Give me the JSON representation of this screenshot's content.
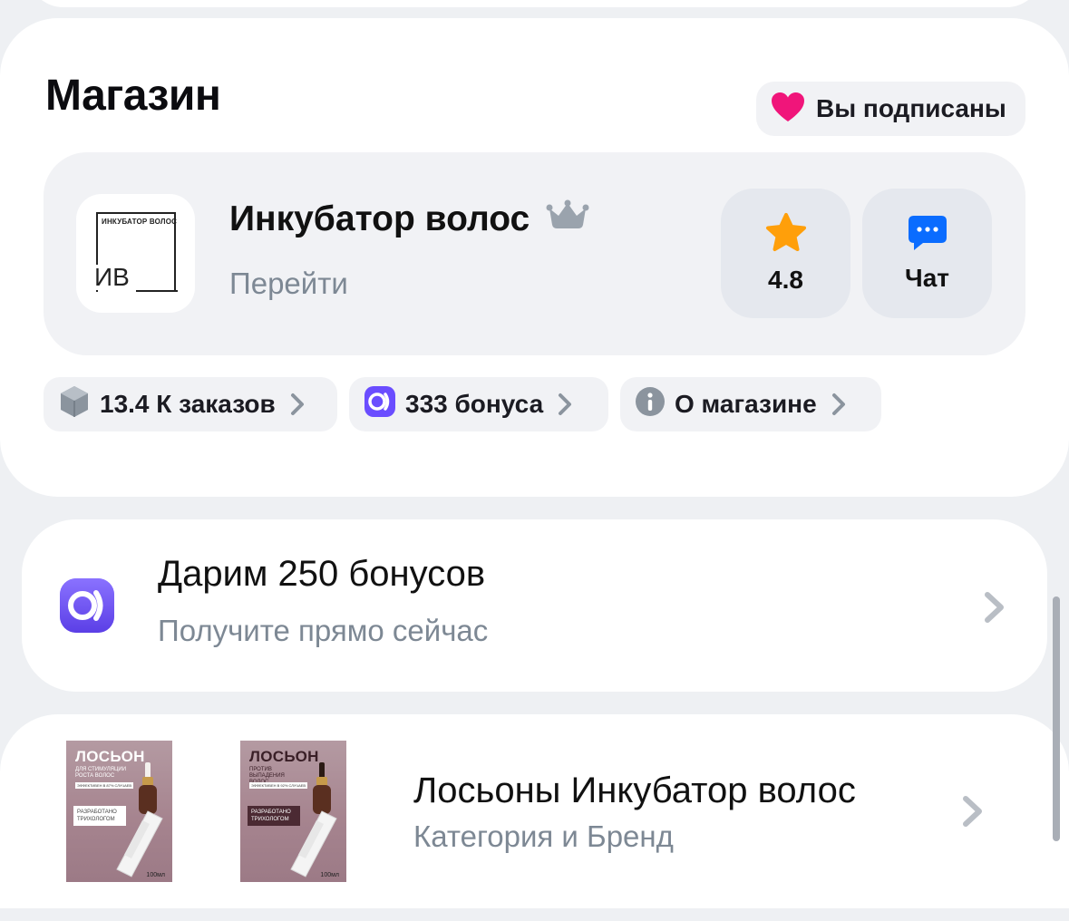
{
  "store": {
    "title": "Магазин",
    "subscribed_label": "Вы подписаны",
    "shop": {
      "logo_top_text": "ИНКУБАТОР ВОЛОС",
      "logo_initials": "ИВ",
      "name": "Инкубатор волос",
      "goto_label": "Перейти",
      "rating": "4.8",
      "chat_label": "Чат"
    },
    "chips": {
      "orders": "13.4 К заказов",
      "bonus": "333 бонуса",
      "about": "О магазине"
    }
  },
  "bonus_card": {
    "title": "Дарим 250 бонусов",
    "subtitle": "Получите прямо сейчас"
  },
  "category_card": {
    "title": "Лосьоны Инкубатор волос",
    "subtitle": "Категория и Бренд",
    "thumbs": [
      {
        "title": "ЛОСЬОН",
        "subtitle": "ДЛЯ СТИМУЛЯЦИИ РОСТА ВОЛОС",
        "strip": "ЭФФЕКТИВЕН В 87% СЛУЧАЕВ",
        "badge": "РАЗРАБОТАНО ТРИХОЛОГОМ",
        "volume": "100мл"
      },
      {
        "title": "ЛОСЬОН",
        "subtitle": "ПРОТИВ ВЫПАДЕНИЯ ВОЛОС",
        "strip": "ЭФФЕКТИВЕН В 92% СЛУЧАЕВ",
        "badge": "РАЗРАБОТАНО ТРИХОЛОГОМ",
        "volume": "100мл"
      }
    ]
  },
  "colors": {
    "heart": "#f0157a",
    "star": "#ff9f0a",
    "chat": "#0a6cff",
    "bonus_icon": "#7b61ff",
    "muted_text": "#7d8894"
  },
  "icons": {
    "subscribed": "heart-icon",
    "shop_badge": "crown-icon",
    "rating": "star-icon",
    "chat": "chat-bubble-icon",
    "orders": "box-icon",
    "bonus": "bonus-coin-icon",
    "about": "info-icon",
    "chevron": "chevron-right-icon"
  }
}
